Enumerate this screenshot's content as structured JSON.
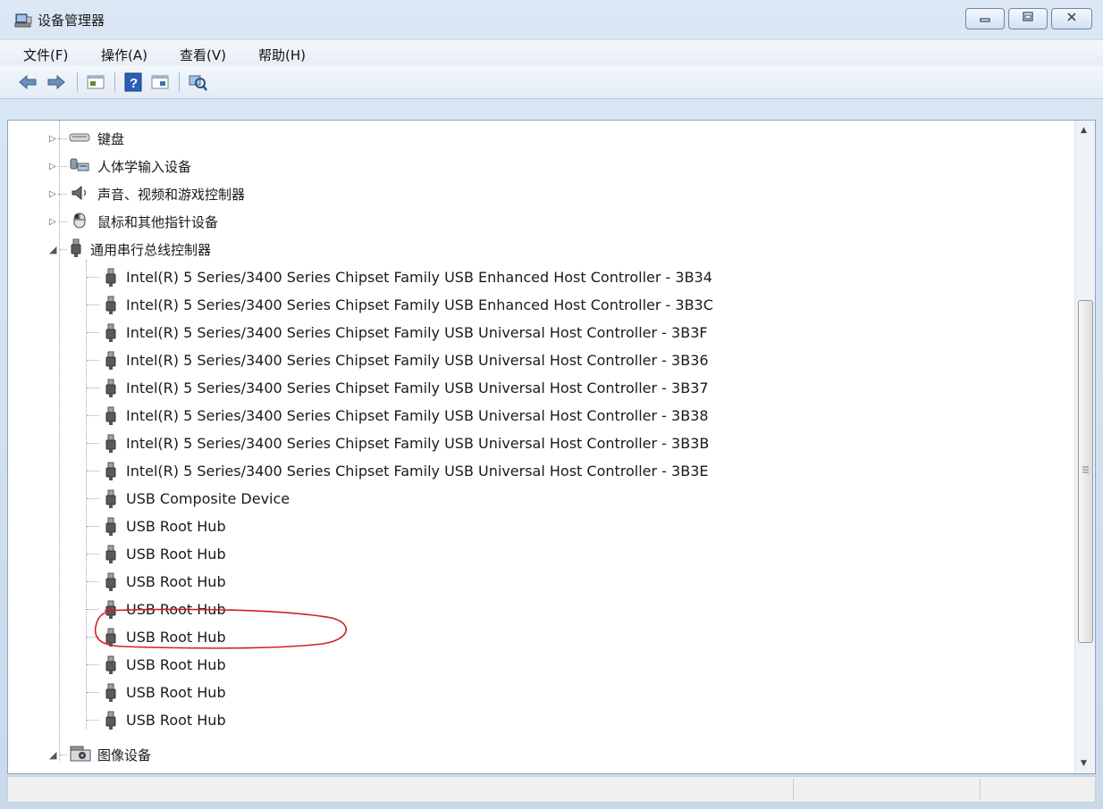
{
  "window": {
    "title": "设备管理器",
    "icon": "device-manager-icon",
    "controls": [
      "minimize",
      "maximize",
      "close"
    ]
  },
  "menu": [
    "文件(F)",
    "操作(A)",
    "查看(V)",
    "帮助(H)"
  ],
  "toolbar": [
    "back-arrow-icon",
    "forward-arrow-icon",
    "properties-icon",
    "help-icon",
    "update-driver-icon",
    "scan-hardware-icon"
  ],
  "tree": {
    "categories_before": [
      {
        "label": "键盘",
        "icon": "keyboard-icon",
        "expanded": false
      },
      {
        "label": "人体学输入设备",
        "icon": "hid-icon",
        "expanded": false
      },
      {
        "label": "声音、视频和游戏控制器",
        "icon": "speaker-icon",
        "expanded": false
      },
      {
        "label": "鼠标和其他指针设备",
        "icon": "mouse-icon",
        "expanded": false
      }
    ],
    "usb_category": {
      "label": "通用串行总线控制器",
      "icon": "usb-icon",
      "expanded": true
    },
    "usb_devices": [
      "Intel(R) 5 Series/3400 Series Chipset Family USB Enhanced Host Controller - 3B34",
      "Intel(R) 5 Series/3400 Series Chipset Family USB Enhanced Host Controller - 3B3C",
      "Intel(R) 5 Series/3400 Series Chipset Family USB Universal Host Controller - 3B3F",
      "Intel(R) 5 Series/3400 Series Chipset Family USB Universal Host Controller - 3B36",
      "Intel(R) 5 Series/3400 Series Chipset Family USB Universal Host Controller - 3B37",
      "Intel(R) 5 Series/3400 Series Chipset Family USB Universal Host Controller - 3B38",
      "Intel(R) 5 Series/3400 Series Chipset Family USB Universal Host Controller - 3B3B",
      "Intel(R) 5 Series/3400 Series Chipset Family USB Universal Host Controller - 3B3E",
      "USB Composite Device",
      "USB Root Hub",
      "USB Root Hub",
      "USB Root Hub",
      "USB Root Hub",
      "USB Root Hub",
      "USB Root Hub",
      "USB Root Hub",
      "USB Root Hub"
    ],
    "highlighted_device": "USB Composite Device",
    "categories_after": [
      {
        "label": "图像设备",
        "icon": "camera-icon",
        "expanded": true
      }
    ]
  },
  "colors": {
    "annotation": "#d0202a",
    "window_bg": "#dbe7f4",
    "tree_bg": "#ffffff"
  }
}
